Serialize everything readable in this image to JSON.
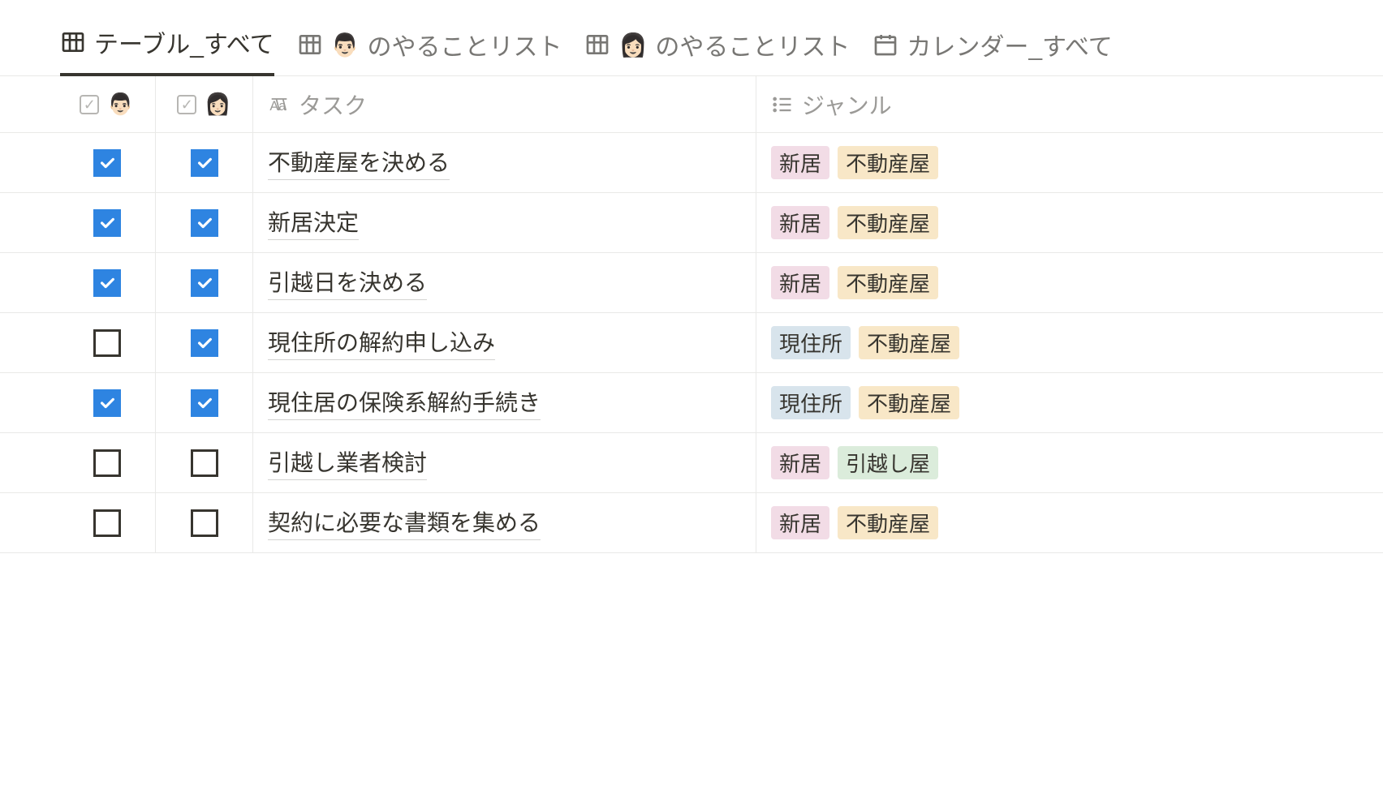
{
  "tabs": [
    {
      "label": "テーブル_すべて",
      "icon": "table",
      "emoji": null,
      "active": true
    },
    {
      "label": "のやることリスト",
      "icon": "table",
      "emoji": "👨🏻",
      "active": false
    },
    {
      "label": "のやることリスト",
      "icon": "table",
      "emoji": "👩🏻",
      "active": false
    },
    {
      "label": "カレンダー_すべて",
      "icon": "calendar",
      "emoji": null,
      "active": false
    }
  ],
  "columns": {
    "person1": "👨🏻",
    "person2": "👩🏻",
    "task_label": "タスク",
    "genre_label": "ジャンル"
  },
  "tags": {
    "new_home": {
      "text": "新居",
      "color": "pink"
    },
    "realtor": {
      "text": "不動産屋",
      "color": "orange"
    },
    "current": {
      "text": "現住所",
      "color": "blue"
    },
    "mover": {
      "text": "引越し屋",
      "color": "green"
    }
  },
  "rows": [
    {
      "c1": true,
      "c2": true,
      "task": "不動産屋を決める",
      "tags": [
        "new_home",
        "realtor"
      ]
    },
    {
      "c1": true,
      "c2": true,
      "task": "新居決定",
      "tags": [
        "new_home",
        "realtor"
      ]
    },
    {
      "c1": true,
      "c2": true,
      "task": "引越日を決める",
      "tags": [
        "new_home",
        "realtor"
      ]
    },
    {
      "c1": false,
      "c2": true,
      "task": "現住所の解約申し込み",
      "tags": [
        "current",
        "realtor"
      ]
    },
    {
      "c1": true,
      "c2": true,
      "task": "現住居の保険系解約手続き",
      "tags": [
        "current",
        "realtor"
      ]
    },
    {
      "c1": false,
      "c2": false,
      "task": "引越し業者検討",
      "tags": [
        "new_home",
        "mover"
      ]
    },
    {
      "c1": false,
      "c2": false,
      "task": "契約に必要な書類を集める",
      "tags": [
        "new_home",
        "realtor"
      ]
    }
  ]
}
